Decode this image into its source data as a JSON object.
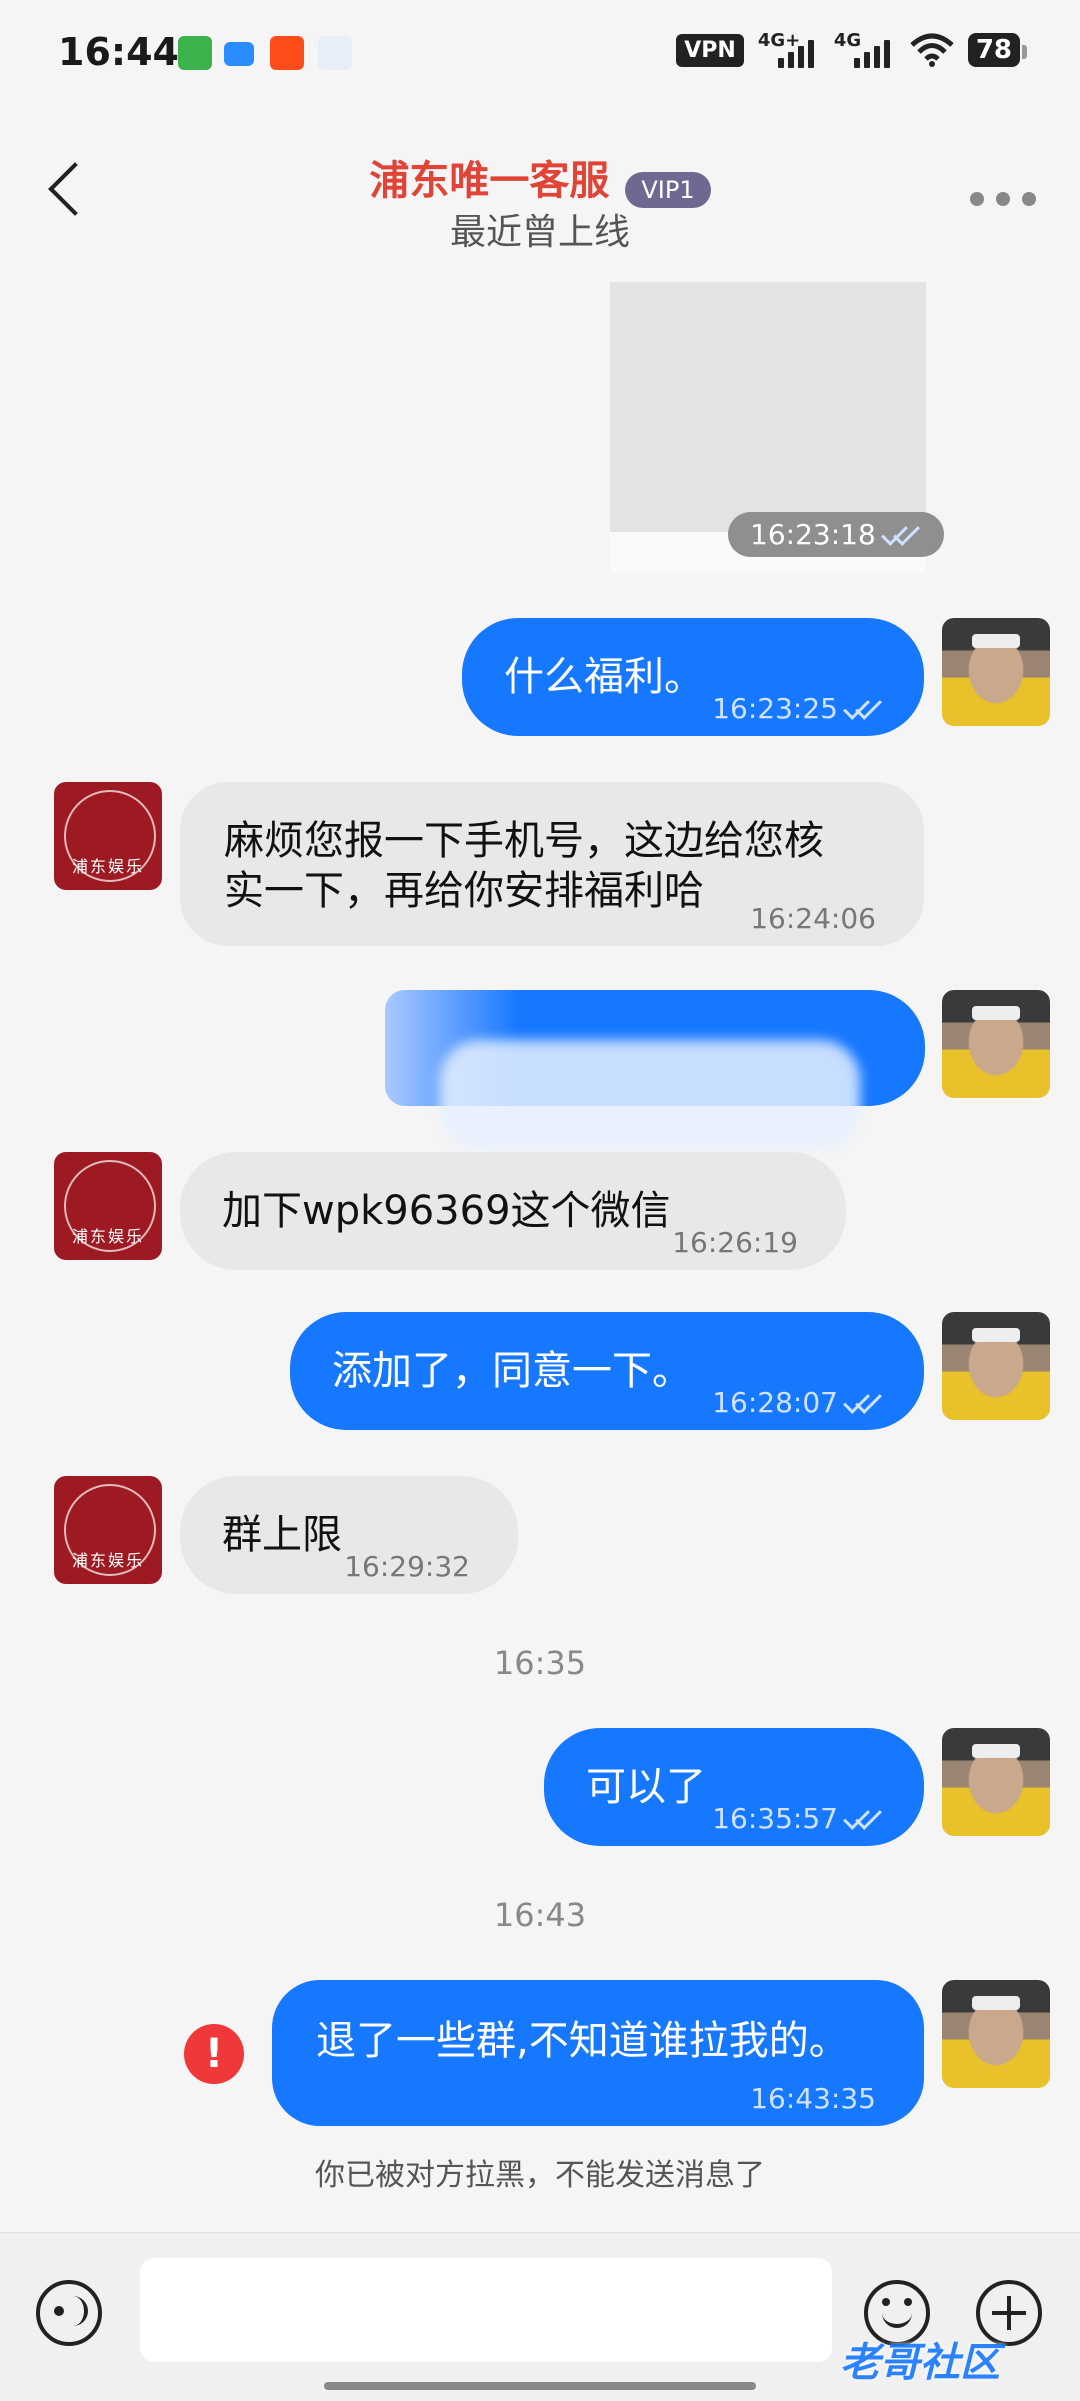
{
  "status_bar": {
    "time": "16:44",
    "vpn": "VPN",
    "net1": "4G+",
    "net2": "4G",
    "battery": "78"
  },
  "header": {
    "title": "浦东唯一客服",
    "vip": "VIP1",
    "subtitle": "最近曾上线"
  },
  "messages": [
    {
      "dir": "out",
      "kind": "image",
      "time": "16:23:18"
    },
    {
      "dir": "out",
      "text": "什么福利。",
      "time": "16:23:25"
    },
    {
      "dir": "in",
      "text_line1": "麻烦您报一下手机号，这边给您核",
      "text_line2": "实一下，再给你安排福利哈",
      "time": "16:24:06"
    },
    {
      "dir": "out",
      "kind": "redacted"
    },
    {
      "dir": "in",
      "text": "加下wpk96369这个微信",
      "time": "16:26:19"
    },
    {
      "dir": "out",
      "text": "添加了，同意一下。",
      "time": "16:28:07"
    },
    {
      "dir": "in",
      "text": "群上限",
      "time": "16:29:32"
    },
    {
      "dir": "out",
      "text": "可以了",
      "time": "16:35:57"
    },
    {
      "dir": "out",
      "text": "退了一些群,不知道谁拉我的。",
      "time": "16:43:35",
      "failed": true
    }
  ],
  "separators": [
    "16:35",
    "16:43"
  ],
  "system": {
    "blocked_notice": "你已被对方拉黑，不能发送消息了"
  },
  "biz_avatar": {
    "mark": "浦东娱乐"
  },
  "watermark": "老哥社区",
  "colors": {
    "accent": "#1677ff",
    "title": "#e04437",
    "error": "#f0383b"
  }
}
